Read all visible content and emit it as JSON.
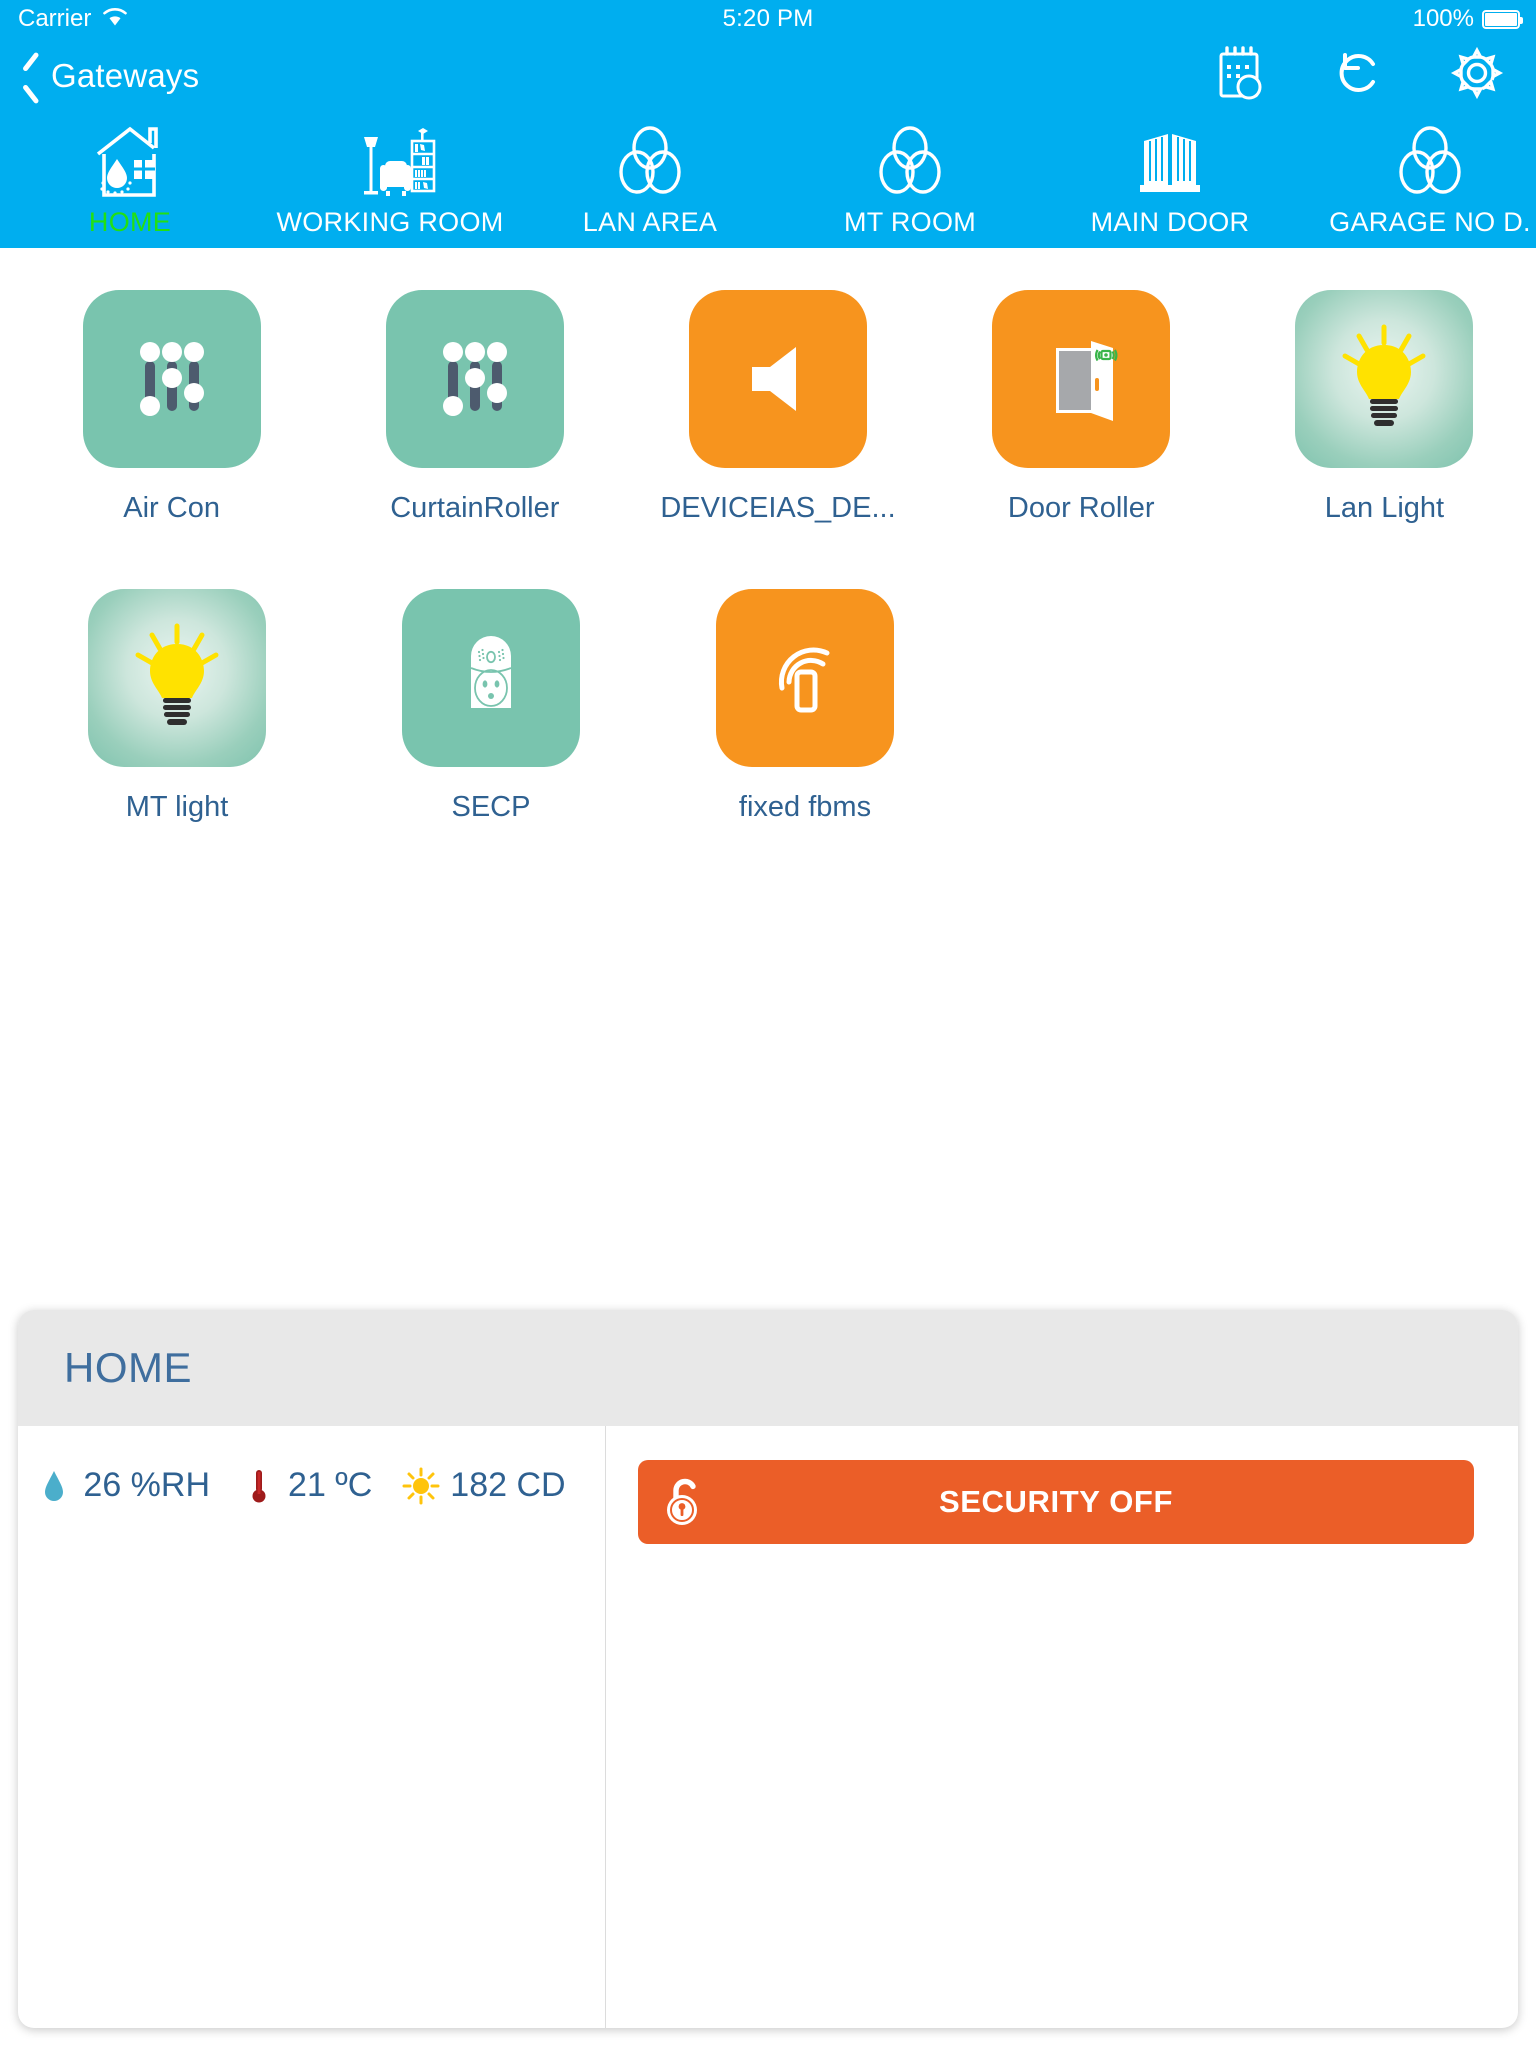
{
  "status_bar": {
    "carrier": "Carrier",
    "wifi_icon": "wifi-icon",
    "time": "5:20 PM",
    "battery_percent": "100%",
    "battery_icon": "battery-full-icon"
  },
  "nav_bar": {
    "back_icon": "chevron-left-icon",
    "back_label": "Gateways",
    "actions": [
      {
        "name": "schedule-icon",
        "label": "schedule-icon"
      },
      {
        "name": "refresh-icon",
        "label": "refresh-icon"
      },
      {
        "name": "gear-icon",
        "label": "gear-icon"
      }
    ]
  },
  "tabs": {
    "active_index": 0,
    "items": [
      {
        "label": "HOME",
        "icon": "house-humidity-icon"
      },
      {
        "label": "WORKING ROOM",
        "icon": "living-room-icon"
      },
      {
        "label": "LAN AREA",
        "icon": "three-circles-icon"
      },
      {
        "label": "MT ROOM",
        "icon": "three-circles-icon"
      },
      {
        "label": "MAIN DOOR",
        "icon": "gate-icon"
      },
      {
        "label": "GARAGE NO D.",
        "icon": "three-circles-icon"
      }
    ]
  },
  "devices": [
    {
      "label": "Air Con",
      "icon": "slider-controls-icon",
      "tile": "green"
    },
    {
      "label": "CurtainRoller",
      "icon": "slider-controls-icon",
      "tile": "green"
    },
    {
      "label": "DEVICEIAS_DE...",
      "icon": "speaker-icon",
      "tile": "orange"
    },
    {
      "label": "Door Roller",
      "icon": "open-door-icon",
      "tile": "orange"
    },
    {
      "label": "Lan Light",
      "icon": "light-bulb-icon",
      "tile": "bulb"
    },
    {
      "label": "MT light",
      "icon": "light-bulb-icon",
      "tile": "bulb"
    },
    {
      "label": "SECP",
      "icon": "power-socket-icon",
      "tile": "green"
    },
    {
      "label": "fixed fbms",
      "icon": "motion-sensor-icon",
      "tile": "orange"
    }
  ],
  "panel": {
    "title": "HOME",
    "sensors": [
      {
        "icon": "water-drop-icon",
        "value": "26 %RH"
      },
      {
        "icon": "thermometer-icon",
        "value": "21 ºC"
      },
      {
        "icon": "sun-icon",
        "value": "182 CD"
      }
    ],
    "security": {
      "icon": "unlock-icon",
      "label": "SECURITY OFF"
    }
  },
  "colors": {
    "brand_blue": "#00AEEF",
    "active_tab_green": "#22E012",
    "tile_green": "#79C4AE",
    "tile_orange": "#F7941E",
    "label_blue": "#2F6191",
    "security_orange": "#EB5E28",
    "panel_header_gray": "#E8E8E8"
  }
}
